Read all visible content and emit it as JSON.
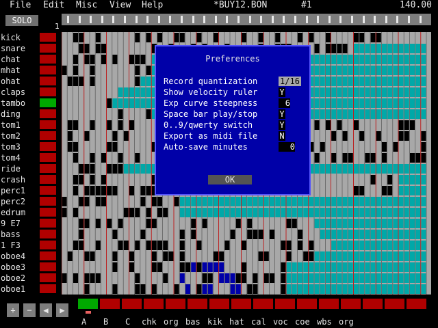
{
  "menu": {
    "file": "File",
    "edit": "Edit",
    "misc": "Misc",
    "view": "View",
    "help": "Help",
    "filename": "*BUY12.BON",
    "pattern": "#1",
    "tempo": "140.00"
  },
  "solo_label": "SOLO",
  "bar_number": "1",
  "tracks": [
    {
      "name": "kick",
      "active": false
    },
    {
      "name": "snare",
      "active": false
    },
    {
      "name": "chat",
      "active": false
    },
    {
      "name": "mhat",
      "active": false
    },
    {
      "name": "ohat",
      "active": false
    },
    {
      "name": "claps",
      "active": false
    },
    {
      "name": "tambo",
      "active": true
    },
    {
      "name": "ding",
      "active": false
    },
    {
      "name": "tom1",
      "active": false
    },
    {
      "name": "tom2",
      "active": false
    },
    {
      "name": "tom3",
      "active": false
    },
    {
      "name": "tom4",
      "active": false
    },
    {
      "name": "ride",
      "active": false
    },
    {
      "name": "crash",
      "active": false
    },
    {
      "name": "perc1",
      "active": false
    },
    {
      "name": "perc2",
      "active": false
    },
    {
      "name": "edrum",
      "active": false
    },
    {
      "name": "9 E7",
      "active": false
    },
    {
      "name": "bass",
      "active": false
    },
    {
      "name": "1 F3",
      "active": false
    },
    {
      "name": "oboe4",
      "active": false
    },
    {
      "name": "oboe3",
      "active": false
    },
    {
      "name": "oboe2",
      "active": false
    },
    {
      "name": "oboe1",
      "active": false
    }
  ],
  "preferences": {
    "title": "Preferences",
    "items": [
      {
        "label": "Record quantization",
        "value": "1/16"
      },
      {
        "label": "Show velocity ruler",
        "value": "Y"
      },
      {
        "label": "Exp curve steepness",
        "value": "6"
      },
      {
        "label": "Space bar play/stop",
        "value": "Y"
      },
      {
        "label": "0..9/qwerty switch",
        "value": "Y"
      },
      {
        "label": "Export as midi file",
        "value": "N"
      },
      {
        "label": "Auto-save minutes",
        "value": "0"
      }
    ],
    "ok_label": "OK"
  },
  "controls": {
    "plus": "+",
    "minus": "−",
    "left": "◀",
    "right": "▶"
  },
  "patterns": {
    "active_index": 0,
    "count": 16,
    "labels": [
      "A",
      "B",
      "C",
      "chk",
      "org",
      "bas",
      "kik",
      "hat",
      "cal",
      "voc",
      "coe",
      "wbs",
      "org"
    ]
  },
  "colors": {
    "grid_gray": "#a8a8a8",
    "note_black": "#000000",
    "teal": "#00a8a8",
    "blue_note": "#0000a8",
    "red": "#b00000",
    "green": "#00a800",
    "dialog_blue": "#0000a8"
  }
}
